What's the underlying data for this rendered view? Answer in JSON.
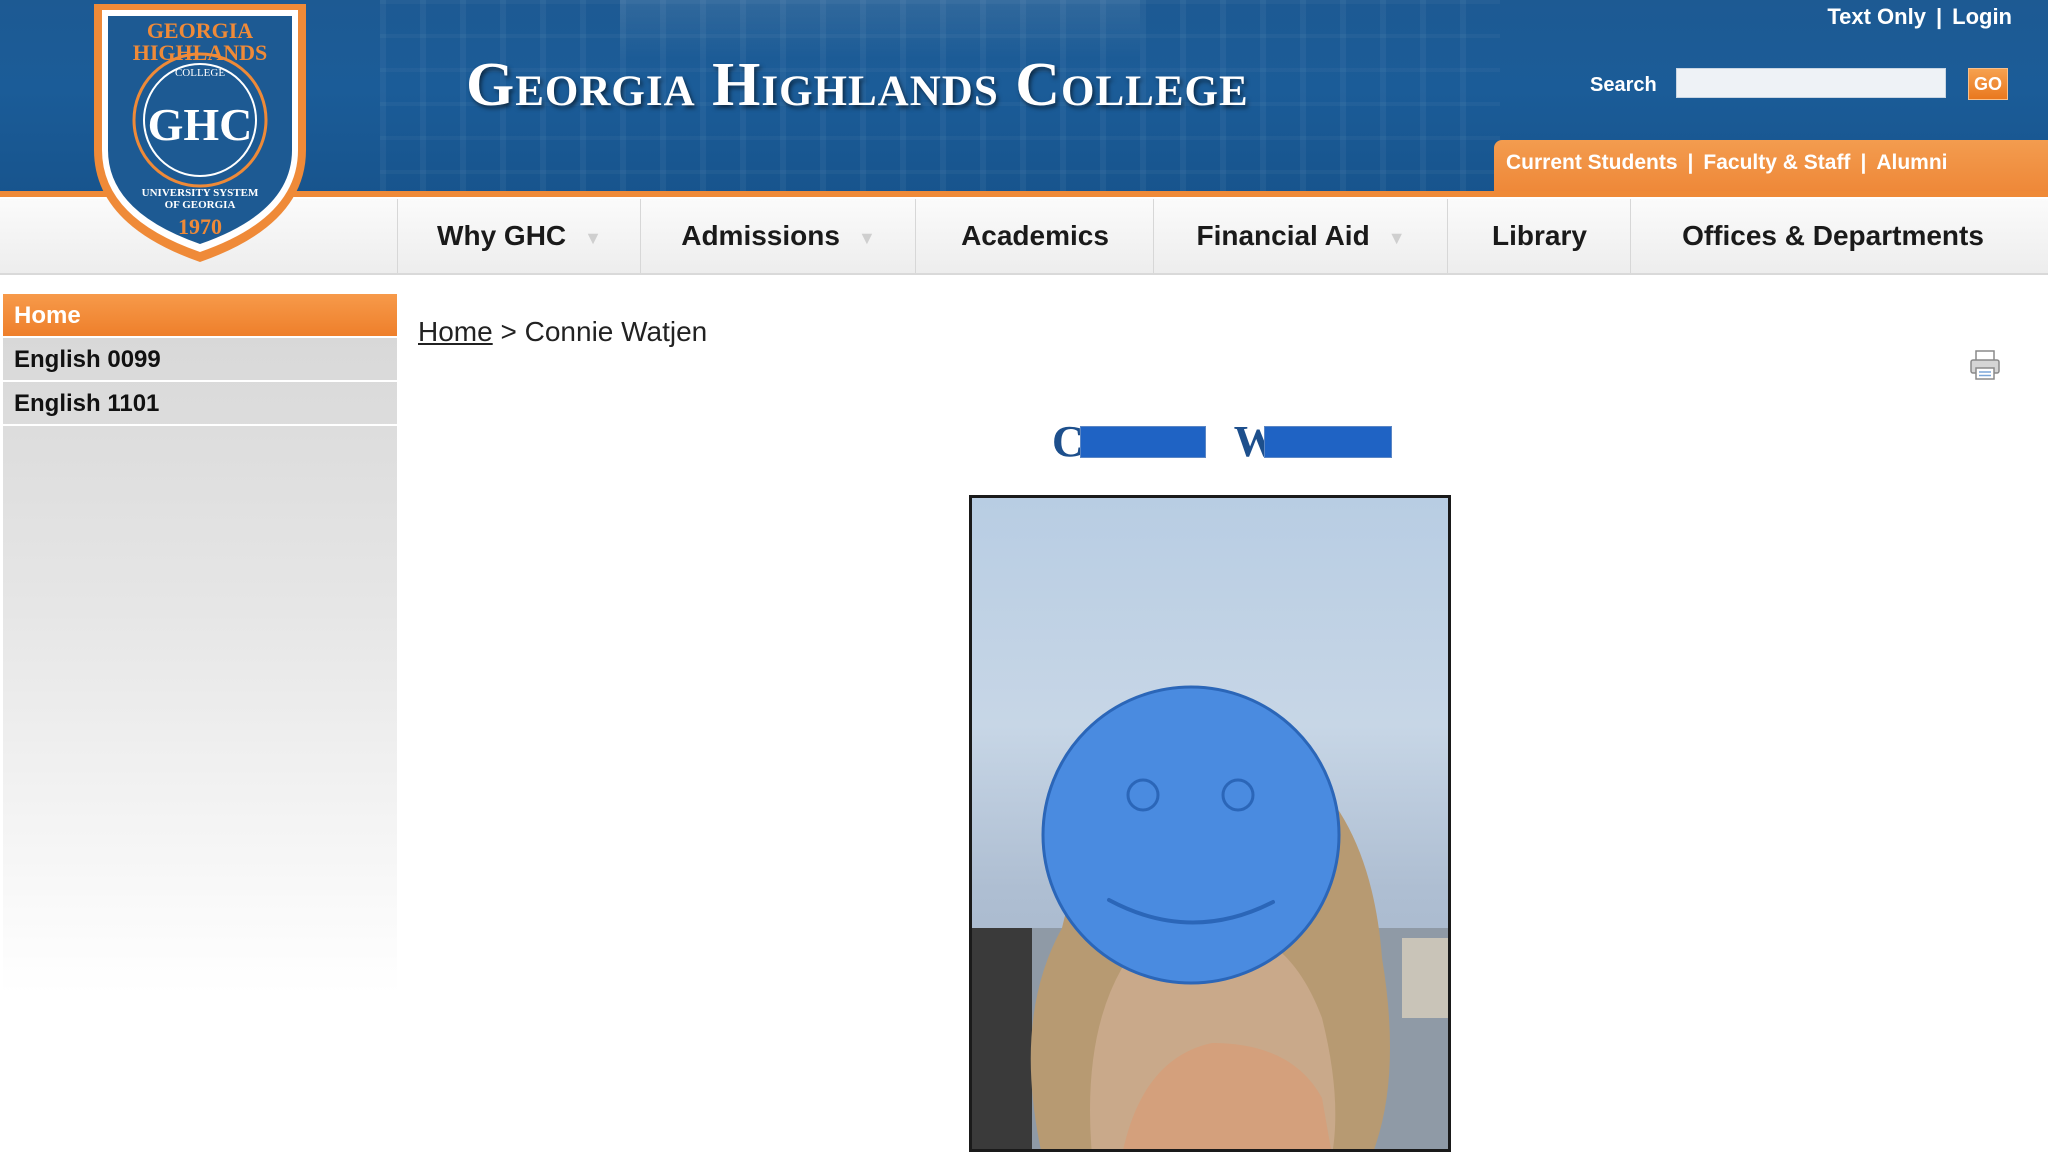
{
  "header": {
    "title": "Georgia Highlands College",
    "utility_links": [
      "Text Only",
      "Login"
    ],
    "search": {
      "label": "Search",
      "value": "",
      "button_label": "GO"
    },
    "audience_links": [
      "Current Students",
      "Faculty & Staff",
      "Alumni"
    ]
  },
  "seal": {
    "top_text": "GEORGIA HIGHLANDS",
    "sub_text": "COLLEGE",
    "monogram": "GHC",
    "bottom_text": "UNIVERSITY SYSTEM OF GEORGIA",
    "year": "1970"
  },
  "nav": {
    "items": [
      {
        "label": "Why GHC",
        "dropdown": true
      },
      {
        "label": "Admissions",
        "dropdown": true
      },
      {
        "label": "Academics",
        "dropdown": false
      },
      {
        "label": "Financial Aid",
        "dropdown": true
      },
      {
        "label": "Library",
        "dropdown": false
      },
      {
        "label": "Offices & Departments",
        "dropdown": false
      }
    ]
  },
  "sidebar": {
    "items": [
      {
        "label": "Home",
        "active": true
      },
      {
        "label": "English 0099",
        "active": false
      },
      {
        "label": "English 1101",
        "active": false
      }
    ]
  },
  "breadcrumb": {
    "home": "Home",
    "separator": ">",
    "current": "Connie Watjen"
  },
  "profile": {
    "name_visible_1": "C",
    "name_visible_2": "W"
  },
  "colors": {
    "header_blue": "#1b5c98",
    "accent_orange": "#ee8636",
    "name_blue": "#1d4f8c",
    "redaction_blue": "#1f63c4",
    "face_overlay_blue": "#4a8be0"
  },
  "icons": [
    "print-icon",
    "smiley-face-icon"
  ]
}
